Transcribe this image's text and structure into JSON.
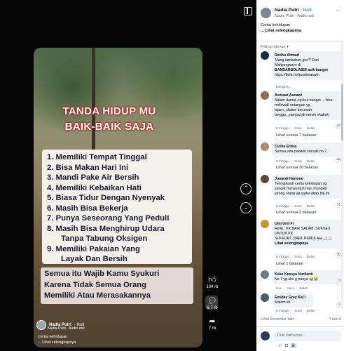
{
  "video": {
    "title_line1": "TANDA HIDUP MU",
    "title_line2": "BAIK-BAIK SAJA",
    "items": [
      "1. Memiliki Tempat Tinggal",
      "2. Bisa Makan Hari Ini",
      "3. Mandi Pake Air Bersih",
      "4. Memiliki Kebaikan Hati",
      "5. Biasa Tidur Dengan Nyenyak",
      "6. Masih Bisa Bekerja",
      "7. Punya Seseorang Yang Peduli",
      "8. Masih Bisa Menghirup Udara",
      "Tanpa Tabung Oksigen",
      "9. Memiliki Pakaian Yang",
      "Layak Dan Bersih"
    ],
    "footer_lines": [
      "Semua itu Wajib Kamu Syukuri",
      "Karena Tidak Semua Orang",
      "Memiliki Atau Merasakannya"
    ],
    "author_name": "Nadia Putri",
    "follow": "· Ikuti",
    "audio": "Nadia Putri · Audio asli",
    "caption_line1": "Cerita kehidupan",
    "caption_line2": "... Lihat selengkapnya"
  },
  "actions": {
    "likes": "104 rb",
    "comments": "6,7 rb",
    "shares": "7 rb"
  },
  "panel": {
    "author_name": "Nadia Putri",
    "follow": "· Ikuti",
    "audio": "Nadia Putri · Audio asli",
    "caption_line1": "Cerita kehidupan",
    "caption_line2": "... Lihat selengkapnya",
    "sort_label": "Paling relevan ▾",
    "comments": [
      {
        "name": "Redho Ahmad",
        "lines": [
          "'Uang tambahan gue?' Dari",
          "Mahjongways di"
        ],
        "bold_line": "BANDARBOLA855 asik banget",
        "link_line": "https://bola.mx/pastimaxwin",
        "meta": [
          "Mengirim..."
        ]
      },
      {
        "name": "Asmawi Asnawi",
        "lines": [
          "Salam damai,,syukur banget ... bisa",
          "melewati rintangan yg",
          "tajam,,,dalam berumah",
          "tangga,,,sampai jdi nenek nkakek"
        ],
        "meta": [
          "8 minggu",
          "Suka",
          "Balas"
        ],
        "react": "47",
        "replies": "Lihat semua 7 balasan"
      },
      {
        "name": "Cicilia Erlina",
        "lines": [
          "Semua ada padaku kecuali no 7"
        ],
        "meta": [
          "6 minggu",
          "Suka",
          "Balas"
        ],
        "react": "44",
        "replies": "Lihat semua 30 balasan"
      },
      {
        "name": "Junaedi Hartono",
        "lines": [
          "Terimakasih cerita kehidupan yg",
          "sangat menyentuh hati ,mungkin",
          "jarang orang yg sadar akan hal ini"
        ],
        "meta": [
          "8 minggu",
          "Suka",
          "Balas"
        ],
        "react": "31",
        "replies": "Lihat semua 2 balasan"
      },
      {
        "name": "Umi Umi Fi",
        "lines": [
          "Hello,, KK BAIK SALAM, SUKSES",
          "UNTUK KK",
          "SUFFORT, DARI, PEMULAH,,🙏🏻🙏🏻"
        ],
        "more": "Lihat selengkapnya",
        "meta": [
          "6 minggu",
          "Suka",
          "Balas"
        ],
        "react": "30",
        "replies": "Lihat 1 balasan"
      },
      {
        "name": "Keke Kessya Nurlianti",
        "lines": [
          "No 7 yg aku g punya 😭😭"
        ],
        "meta": [
          "Hari",
          "Suka",
          "Balas"
        ],
        "react": "3"
      },
      {
        "name": "Emiday Grey Kai'i",
        "lines": [
          "Malem kk"
        ],
        "meta": [
          "6 minggu",
          "Suka",
          "Balas"
        ],
        "react": "2"
      }
    ],
    "compose_label": "Lihat komentar lain",
    "compose_count": "7 dari 6",
    "compose_placeholder": "Tulis komentar..."
  }
}
